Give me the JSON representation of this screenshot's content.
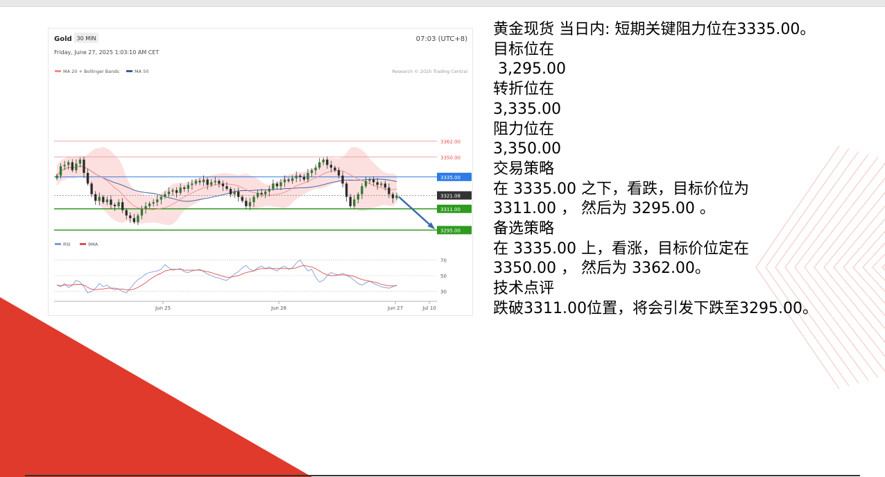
{
  "colors": {
    "accent_red": "#e03a2c",
    "bollinger_fill": "#fbd5d5",
    "ma20": "#f28c8c",
    "ma50": "#3c5a9a",
    "resistance": "#f0a3a3",
    "pivot": "#2e7be6",
    "support": "#2e9a1e",
    "current_price": "#333333",
    "arrow": "#3d6aa8",
    "rsi": "#7d9bd6",
    "rsi_ma": "#e0504a",
    "candle_up": "#2f7a2f",
    "candle_down": "#2b2b2b"
  },
  "chart_header": {
    "symbol": "Gold",
    "timeframe": "30 MIN",
    "clock": "07:03 (UTC+8)",
    "datetime": "Friday, June 27, 2025 1:03:10 AM CET",
    "legend_ma20": "MA 20 + Bollinger Bands",
    "legend_ma50": "MA 50",
    "credit": "Research © 2025 Trading Central",
    "rsi_legend_rsi": "RSI",
    "rsi_legend_ma": "9MA"
  },
  "chart_data": {
    "type": "candlestick",
    "x_ticks": [
      "Jun 25",
      "Jun 26",
      "Jun 27",
      "Jul 10"
    ],
    "y_range": [
      3290,
      3385
    ],
    "levels": [
      {
        "label": "3362.00",
        "value": 3362.0,
        "kind": "resistance"
      },
      {
        "label": "3350.00",
        "value": 3350.0,
        "kind": "resistance"
      },
      {
        "label": "3335.00",
        "value": 3335.0,
        "kind": "pivot"
      },
      {
        "label": "3321.08",
        "value": 3321.08,
        "kind": "current"
      },
      {
        "label": "3311.00",
        "value": 3311.0,
        "kind": "support"
      },
      {
        "label": "3295.00",
        "value": 3295.0,
        "kind": "support"
      }
    ],
    "close_series": [
      3336,
      3343,
      3344,
      3346,
      3340,
      3345,
      3348,
      3338,
      3330,
      3322,
      3317,
      3320,
      3316,
      3318,
      3314,
      3313,
      3316,
      3310,
      3306,
      3304,
      3301,
      3306,
      3311,
      3313,
      3315,
      3316,
      3318,
      3320,
      3322,
      3324,
      3325,
      3323,
      3327,
      3326,
      3329,
      3330,
      3332,
      3331,
      3333,
      3329,
      3331,
      3332,
      3330,
      3328,
      3326,
      3322,
      3324,
      3320,
      3317,
      3313,
      3316,
      3320,
      3323,
      3322,
      3324,
      3326,
      3330,
      3328,
      3331,
      3333,
      3332,
      3334,
      3336,
      3335,
      3333,
      3338,
      3340,
      3342,
      3346,
      3348,
      3344,
      3342,
      3340,
      3336,
      3330,
      3320,
      3313,
      3318,
      3322,
      3328,
      3332,
      3333,
      3331,
      3329,
      3330,
      3327,
      3322,
      3319,
      3321
    ],
    "projection": {
      "from": 3321.08,
      "to": 3295.0
    },
    "rsi": {
      "y_ticks": [
        70,
        50,
        30
      ],
      "range": [
        20,
        80
      ],
      "values": [
        38,
        36,
        40,
        35,
        38,
        44,
        42,
        36,
        28,
        30,
        34,
        40,
        36,
        38,
        34,
        32,
        33,
        30,
        28,
        34,
        40,
        45,
        48,
        52,
        54,
        55,
        56,
        58,
        64,
        60,
        57,
        58,
        59,
        55,
        54,
        56,
        57,
        58,
        55,
        52,
        50,
        48,
        47,
        45,
        44,
        48,
        52,
        55,
        60,
        63,
        58,
        56,
        60,
        62,
        59,
        61,
        58,
        56,
        60,
        62,
        58,
        60,
        66,
        70,
        62,
        56,
        58,
        48,
        42,
        44,
        50,
        54,
        52,
        51,
        53,
        50,
        48,
        44,
        40,
        38,
        41,
        43,
        40,
        38,
        36,
        35,
        34,
        36,
        38
      ],
      "ma_values": [
        38,
        37,
        38,
        38,
        38,
        39,
        39,
        38,
        35,
        33,
        32,
        33,
        33,
        34,
        34,
        34,
        33,
        33,
        32,
        32,
        33,
        35,
        38,
        41,
        45,
        48,
        51,
        53,
        56,
        57,
        58,
        58,
        58,
        57,
        57,
        57,
        57,
        57,
        56,
        55,
        54,
        52,
        51,
        49,
        48,
        48,
        49,
        50,
        52,
        54,
        55,
        56,
        58,
        59,
        59,
        59,
        59,
        59,
        59,
        59,
        59,
        59,
        60,
        62,
        63,
        62,
        61,
        59,
        56,
        53,
        51,
        50,
        50,
        51,
        51,
        51,
        50,
        49,
        47,
        45,
        44,
        43,
        42,
        41,
        39,
        38,
        37,
        37,
        37
      ]
    }
  },
  "analysis": {
    "title": "黄金现货 当日内: 短期关键阻力位在3335.00。",
    "target_label": "目标位在",
    "target_value": " 3,295.00",
    "pivot_label": "转折位在",
    "pivot_value": "3,335.00",
    "resistance_label": "阻力位在",
    "resistance_value": "3,350.00",
    "strategy_label": "交易策略",
    "strategy_line1": "在 3335.00 之下，看跌，目标价位为",
    "strategy_line2": "3311.00 ， 然后为 3295.00 。",
    "alt_label": "备选策略",
    "alt_line1": "在 3335.00 上，看涨，目标价位定在",
    "alt_line2": "3350.00 ， 然后为 3362.00。",
    "comment_label": "技术点评",
    "comment_line": "跌破3311.00位置，将会引发下跌至3295.00。"
  }
}
